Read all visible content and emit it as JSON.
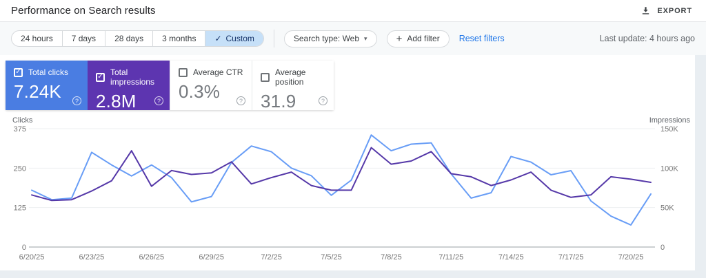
{
  "header": {
    "title": "Performance on Search results",
    "export_label": "EXPORT"
  },
  "filter_bar": {
    "date_ranges": [
      {
        "label": "24 hours",
        "selected": false
      },
      {
        "label": "7 days",
        "selected": false
      },
      {
        "label": "28 days",
        "selected": false
      },
      {
        "label": "3 months",
        "selected": false
      },
      {
        "label": "Custom",
        "selected": true
      }
    ],
    "search_type_label": "Search type: Web",
    "add_filter_label": "Add filter",
    "reset_filters_label": "Reset filters",
    "last_update": "Last update: 4 hours ago"
  },
  "metric_cards": [
    {
      "label": "Total clicks",
      "value": "7.24K",
      "checked": true,
      "bg": "#4a7de2"
    },
    {
      "label": "Total impressions",
      "value": "2.8M",
      "checked": true,
      "bg": "#5d35b0"
    },
    {
      "label": "Average CTR",
      "value": "0.3%",
      "checked": false,
      "bg": ""
    },
    {
      "label": "Average position",
      "value": "31.9",
      "checked": false,
      "bg": ""
    }
  ],
  "icons": {
    "check": "✓",
    "plus": "+",
    "caret_down": "▾",
    "help": "?"
  },
  "colors": {
    "clicks_line": "#689df6",
    "impressions_line": "#5538a8",
    "clicks_card": "#4a7de2",
    "impressions_card": "#5d35b0",
    "link_blue": "#1a73e8",
    "selected_chip_bg": "#c6e0f8"
  },
  "chart_data": {
    "type": "line",
    "x": [
      "6/20/25",
      "6/21/25",
      "6/22/25",
      "6/23/25",
      "6/24/25",
      "6/25/25",
      "6/26/25",
      "6/27/25",
      "6/28/25",
      "6/29/25",
      "6/30/25",
      "7/1/25",
      "7/2/25",
      "7/3/25",
      "7/4/25",
      "7/5/25",
      "7/6/25",
      "7/7/25",
      "7/8/25",
      "7/9/25",
      "7/10/25",
      "7/11/25",
      "7/12/25",
      "7/13/25",
      "7/14/25",
      "7/15/25",
      "7/16/25",
      "7/17/25",
      "7/18/25",
      "7/19/25",
      "7/20/25",
      "7/21/25"
    ],
    "x_tick_every": 3,
    "series": [
      {
        "name": "Clicks",
        "axis": "left",
        "color": "#689df6",
        "values": [
          180,
          150,
          155,
          300,
          260,
          225,
          260,
          220,
          143,
          160,
          268,
          320,
          302,
          250,
          226,
          164,
          212,
          355,
          305,
          326,
          330,
          232,
          155,
          172,
          287,
          269,
          229,
          242,
          146,
          98,
          70,
          168
        ]
      },
      {
        "name": "Impressions",
        "axis": "right",
        "color": "#5538a8",
        "unit": "K",
        "values": [
          66,
          59,
          60,
          71,
          84,
          122,
          77,
          97,
          92,
          94,
          108,
          80,
          88,
          95,
          78,
          72,
          72,
          126,
          105,
          109,
          121,
          93,
          89,
          78,
          85,
          95,
          72,
          63,
          66,
          89,
          86,
          82
        ]
      }
    ],
    "left_axis": {
      "label": "Clicks",
      "max": 375,
      "ticks": [
        "375",
        "250",
        "125",
        "0"
      ],
      "tick_values": [
        375,
        250,
        125,
        0
      ]
    },
    "right_axis": {
      "label": "Impressions",
      "max": 150,
      "ticks": [
        "150K",
        "100K",
        "50K",
        "0"
      ]
    },
    "grid": true,
    "legend_position": "none"
  }
}
